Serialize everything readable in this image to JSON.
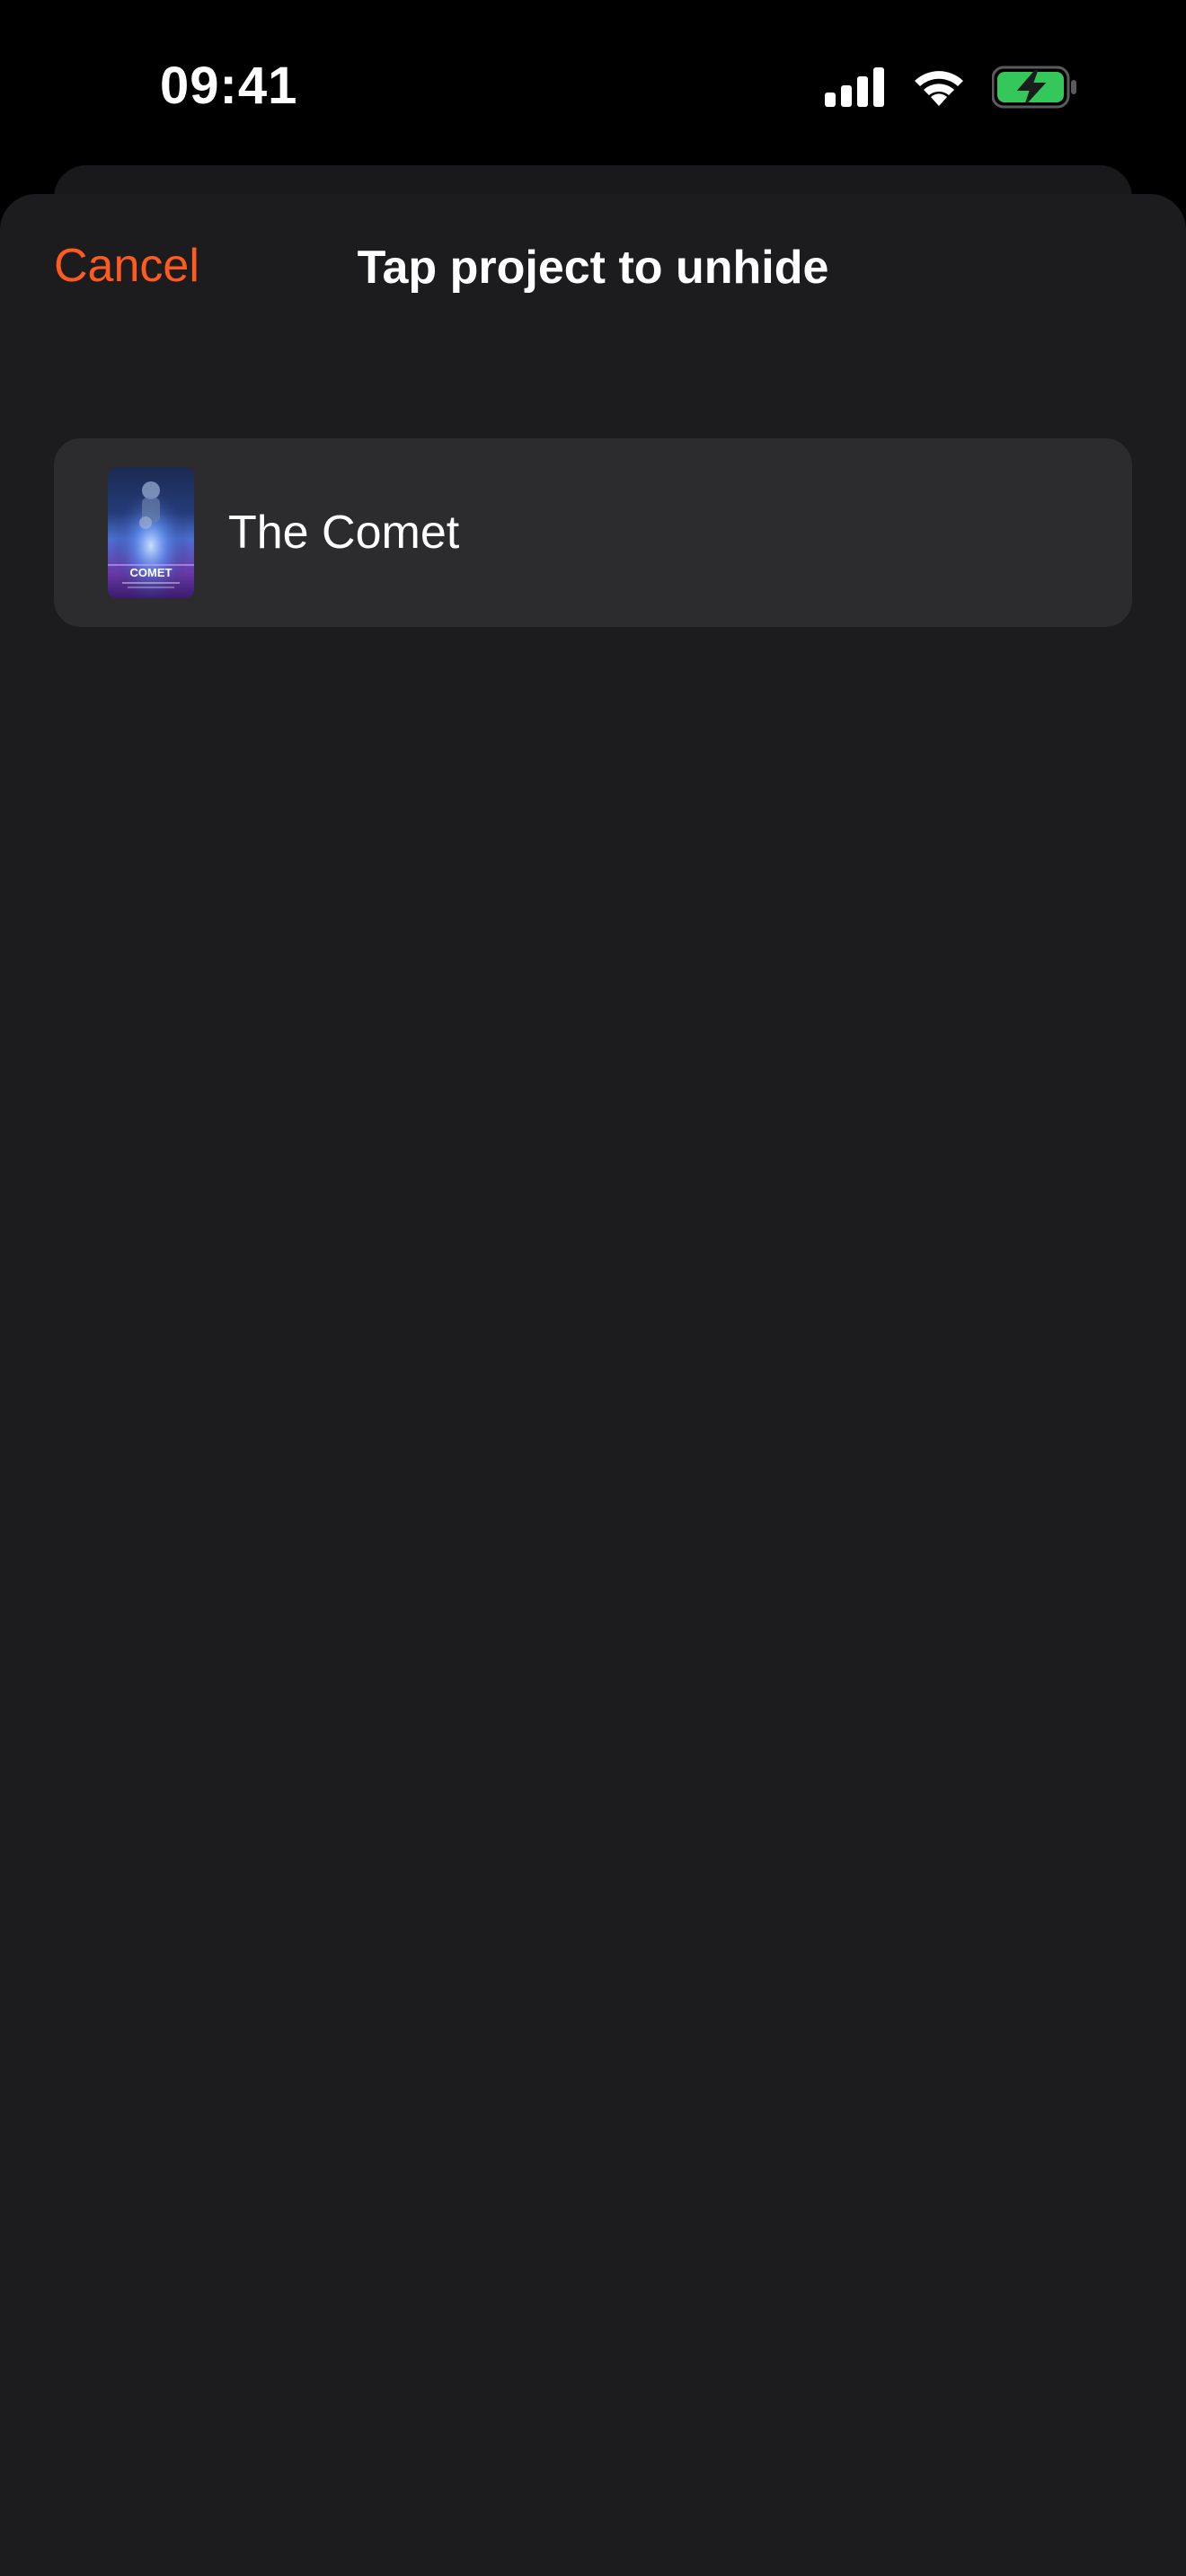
{
  "status_bar": {
    "time": "09:41",
    "icons": [
      "cellular-signal-icon",
      "wifi-icon",
      "battery-charging-icon"
    ],
    "battery_color": "#34c759"
  },
  "nav": {
    "cancel_label": "Cancel",
    "title": "Tap project to unhide"
  },
  "colors": {
    "accent": "#ff5a1f",
    "sheet_background": "#1c1c1e",
    "row_background": "#2c2c2e"
  },
  "projects": [
    {
      "title": "The Comet",
      "poster_text": "COMET",
      "poster_icon": "poster-thumbnail"
    }
  ]
}
